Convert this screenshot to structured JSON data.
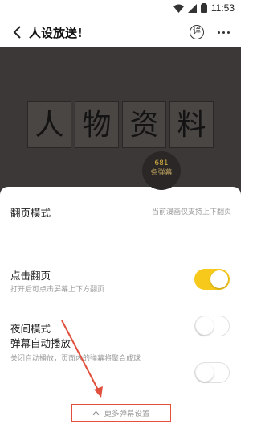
{
  "status_bar": {
    "time": "11:53"
  },
  "header": {
    "title": "人设放送!",
    "detail_label": "详"
  },
  "manga": {
    "panel_chars": [
      "人",
      "物",
      "资",
      "料"
    ]
  },
  "danmaku_badge": {
    "count": "681",
    "unit": "条弹幕"
  },
  "settings": {
    "page_mode": {
      "label": "翻页模式",
      "hint": "当前漫画仅支持上下翻页"
    },
    "tap_page": {
      "label": "点击翻页",
      "sub": "打开后可点击屏幕上下方翻页",
      "on": true
    },
    "night_mode": {
      "label": "夜间模式",
      "on": false
    },
    "autoplay": {
      "label": "弹幕自动播放",
      "sub": "关闭自动播放，页面内的弹幕将聚合成球",
      "on": false
    },
    "more_button": "更多弹幕设置"
  },
  "colors": {
    "accent": "#f6c91a",
    "annotation": "#e0503d",
    "manga_bg": "#3b3837"
  }
}
